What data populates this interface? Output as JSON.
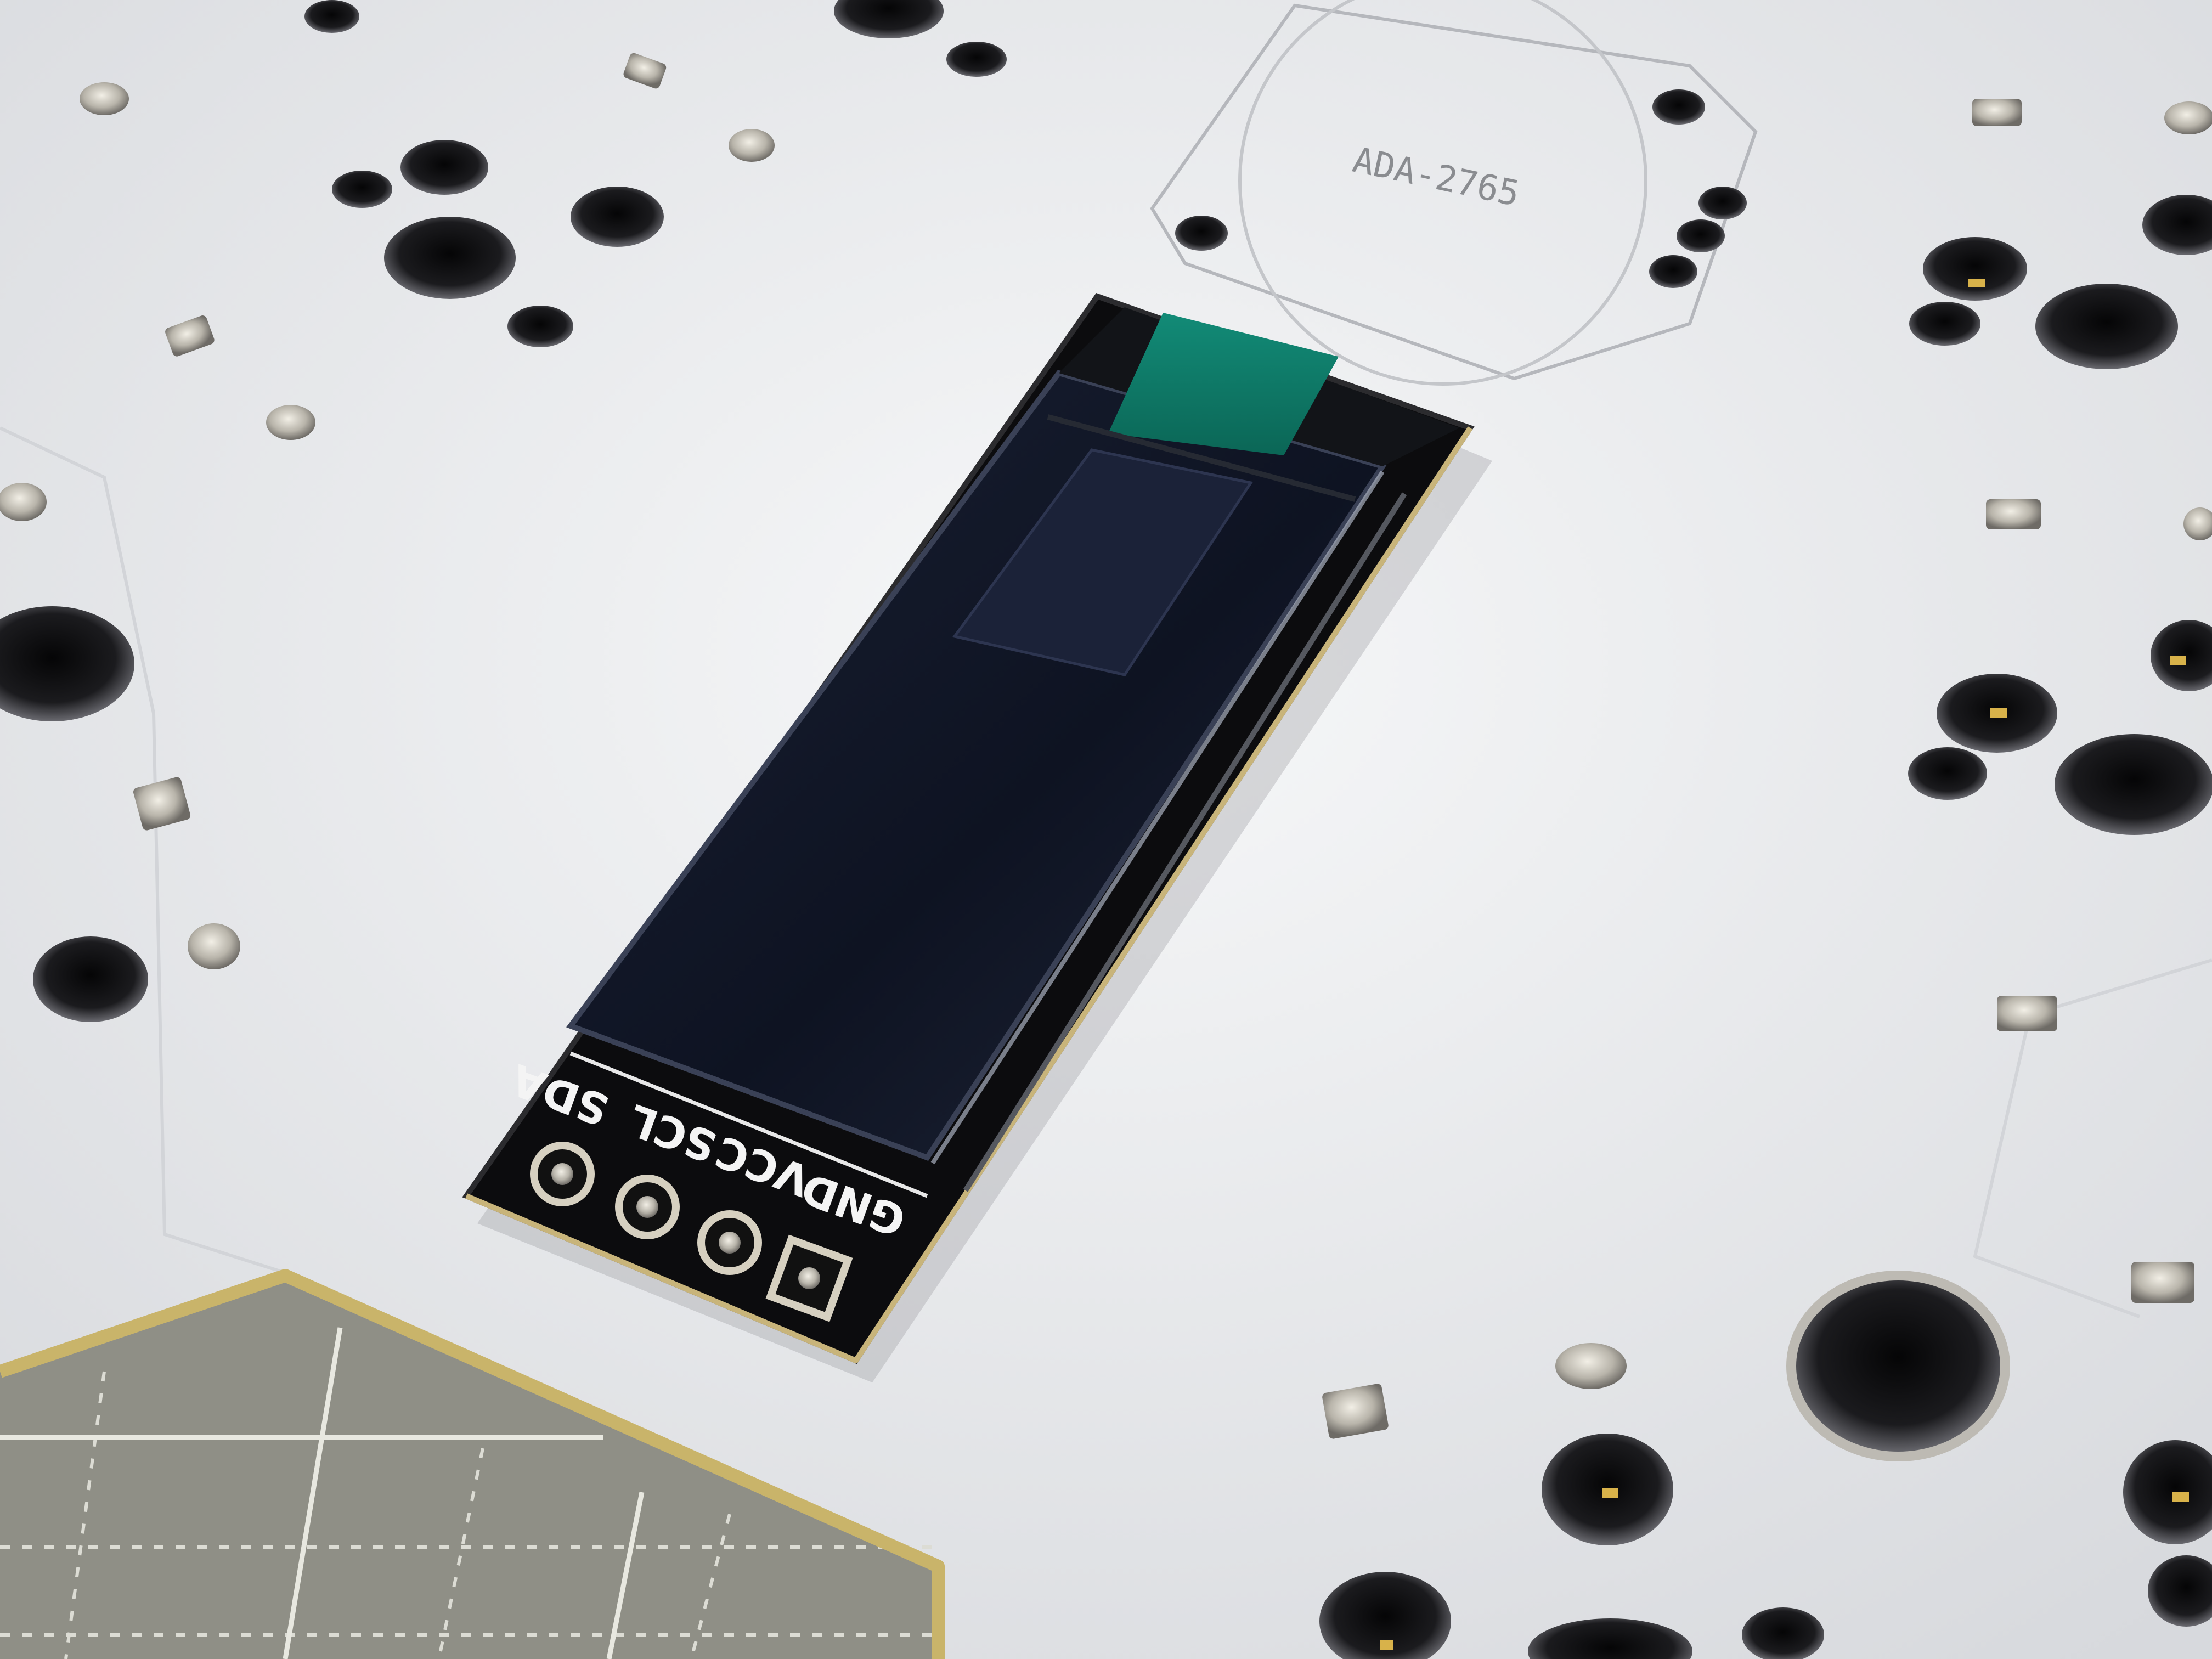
{
  "photo": {
    "part_label": "ADA-2765",
    "pin_labels": [
      "SDA",
      "SCL",
      "VCC",
      "GND"
    ]
  },
  "colors": {
    "pcb_white": "#f2f3f5",
    "hole_dark": "#1a1a1c",
    "oled_board": "#0c0c0e",
    "oled_glass": "#141a2a",
    "ribbon_tab": "#0f7a68",
    "cutting_mat": "#8f8f86",
    "acrylic_edge": "#c9b46a"
  }
}
